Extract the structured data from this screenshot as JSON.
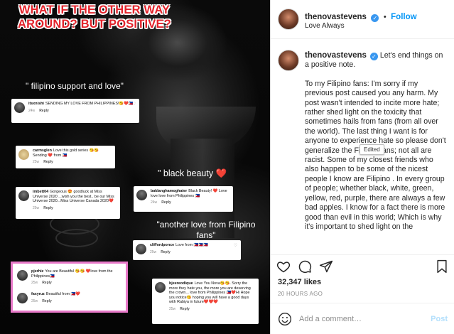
{
  "image": {
    "headline": "WHAT IF THE OTHER WAY AROUND? BUT POSITIVE?",
    "captions": {
      "filipino_support": "\" filipino support and love\"",
      "black_beauty": "\" black beauty",
      "black_beauty_heart": "❤️",
      "another_love": "\"another love from Filipino fans\""
    },
    "comments": [
      {
        "user": "itsxnishi",
        "text": "SENDING MY LOVE FROM PHILIPPINES!😘❤️🇵🇭",
        "meta": "24w",
        "reply": "Reply"
      },
      {
        "user": "carmsglen",
        "text": "Love this gold series 😘😘 Sending ❤️ from 🇵🇭",
        "meta": "25w",
        "reply": "Reply"
      },
      {
        "user": "imbett04",
        "text": "Gorgeous 😍 goodluck at Miss Universe 2020 ...wish you the best.. be our Miss Universe 2020...Miss Universe Canada 2020❤️",
        "meta": "25w",
        "reply": "Reply"
      },
      {
        "user": "baklanghamoghater",
        "text": "Black Beauty! ❤️ Love love love from Philippines 🇵🇭",
        "meta": "24w",
        "reply": "Reply"
      },
      {
        "user": "cliffordponce",
        "text": "Love from 🇵🇭🇵🇭🇵🇭",
        "meta": "25w",
        "reply": "Reply"
      },
      {
        "user": "pjerhiz",
        "text": "You are Beautiful 😘😘 ❤️love from the Philippines🇵🇭",
        "meta": "25w",
        "reply": "Reply"
      },
      {
        "user": "faxyruz",
        "text": "Beautiful from 🇵🇭❤️",
        "meta": "25w",
        "reply": "Reply"
      },
      {
        "user": "bjeereodique",
        "text": "Love You Nova😘😘. Sorry the more they hate you, the more you are deserving the crown... love from Philippines 🇵🇭❤️Hi Hope you notice😘 hoping you will have a good days with Rabiya in future❤️❤️❤️",
        "meta": "25w",
        "reply": "Reply"
      }
    ]
  },
  "header": {
    "username": "thenovastevens",
    "verified_icon": "✓",
    "separator": "•",
    "follow_label": "Follow",
    "location": "Love Always"
  },
  "caption": {
    "username": "thenovastevens",
    "paragraphs": [
      "Let's end things on a positive note.",
      "To my Filipino fans: I'm sorry if my previous post caused you any harm. My post wasn't intended to incite more hate; rather shed light on the toxicity that sometimes hails from fans (from all over the world). The last thing I want is for anyone to experience hate so please don't generalize the Filipino fans; not all are racist. Some of my closest friends who also happen to be some of the nicest people I know are Filipino . In every group of people; whether black, white, green, yellow, red, purple, there are always a few bad apples. I know for a fact there is more good than evil in this world; Which is why it's important to shed light on the"
    ],
    "tooltip": "Edited"
  },
  "actions": {
    "icons": [
      "heart-icon",
      "comment-icon",
      "share-icon",
      "bookmark-icon"
    ],
    "likes": "32,347 likes",
    "time_ago": "20 HOURS AGO"
  },
  "add_comment": {
    "placeholder": "Add a comment…",
    "post_label": "Post"
  }
}
